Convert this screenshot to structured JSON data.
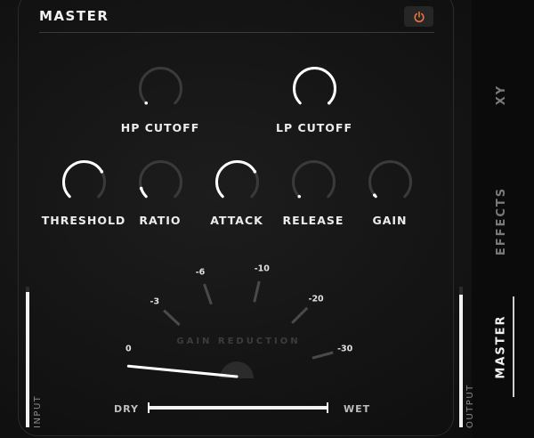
{
  "panel": {
    "title": "MASTER"
  },
  "colors": {
    "accent": "#e8743b",
    "knob_active": "#ffffff",
    "knob_track": "#3a3a3a"
  },
  "knobs": {
    "hp_cutoff": {
      "label": "HP CUTOFF",
      "value": 0.0,
      "active": false
    },
    "lp_cutoff": {
      "label": "LP CUTOFF",
      "value": 1.0,
      "active": true
    },
    "threshold": {
      "label": "THRESHOLD",
      "value": 0.72,
      "active": true
    },
    "ratio": {
      "label": "RATIO",
      "value": 0.1,
      "active": false
    },
    "attack": {
      "label": "ATTACK",
      "value": 0.72,
      "active": true
    },
    "release": {
      "label": "RELEASE",
      "value": 0.0,
      "active": false
    },
    "gain": {
      "label": "GAIN",
      "value": 0.02,
      "active": false
    }
  },
  "gain_reduction": {
    "title": "GAIN REDUCTION",
    "ticks": [
      "0",
      "-3",
      "-6",
      "-10",
      "-20",
      "-30"
    ],
    "needle_value": 0
  },
  "meters": {
    "input": {
      "label": "INPUT",
      "level": 0.96
    },
    "output": {
      "label": "OUTPUT",
      "level": 0.94
    }
  },
  "mix": {
    "dry_label": "DRY",
    "wet_label": "WET",
    "value": 1.0
  },
  "tabs": [
    {
      "label": "XY",
      "active": false
    },
    {
      "label": "EFFECTS",
      "active": false
    },
    {
      "label": "MASTER",
      "active": true
    }
  ],
  "icons": {
    "power": "power-icon"
  }
}
